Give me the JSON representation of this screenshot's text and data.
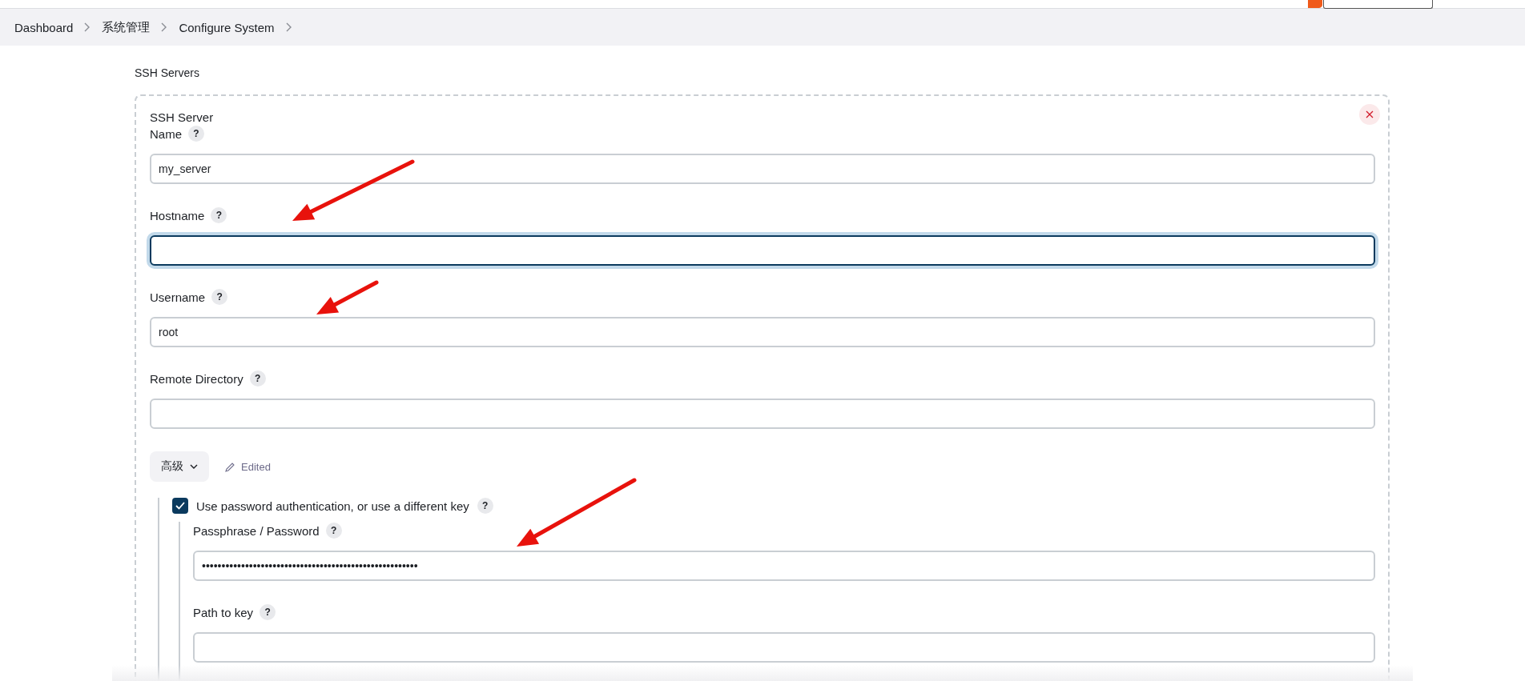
{
  "breadcrumbs": [
    {
      "label": "Dashboard"
    },
    {
      "label": "系统管理"
    },
    {
      "label": "Configure System"
    }
  ],
  "section_title": "SSH Servers",
  "server": {
    "title": "SSH Server",
    "fields": [
      {
        "label": "Name",
        "help": "?",
        "value": "my_server",
        "focused": false
      },
      {
        "label": "Hostname",
        "help": "?",
        "focused": true
      },
      {
        "label": "Username",
        "help": "?",
        "value": "root",
        "focused": false
      },
      {
        "label": "Remote Directory",
        "help": "?",
        "focused": false
      }
    ],
    "advanced_button": "高级",
    "edited_label": "Edited",
    "use_password": {
      "label": "Use password authentication, or use a different key",
      "help": "?",
      "checked": true
    },
    "auth_fields": [
      {
        "label": "Passphrase / Password",
        "help": "?",
        "value": "•••••••••••••••••••••••••••••••••••••••••••••••••••••••",
        "focused": false
      },
      {
        "label": "Path to key",
        "help": "?",
        "focused": false
      }
    ]
  }
}
